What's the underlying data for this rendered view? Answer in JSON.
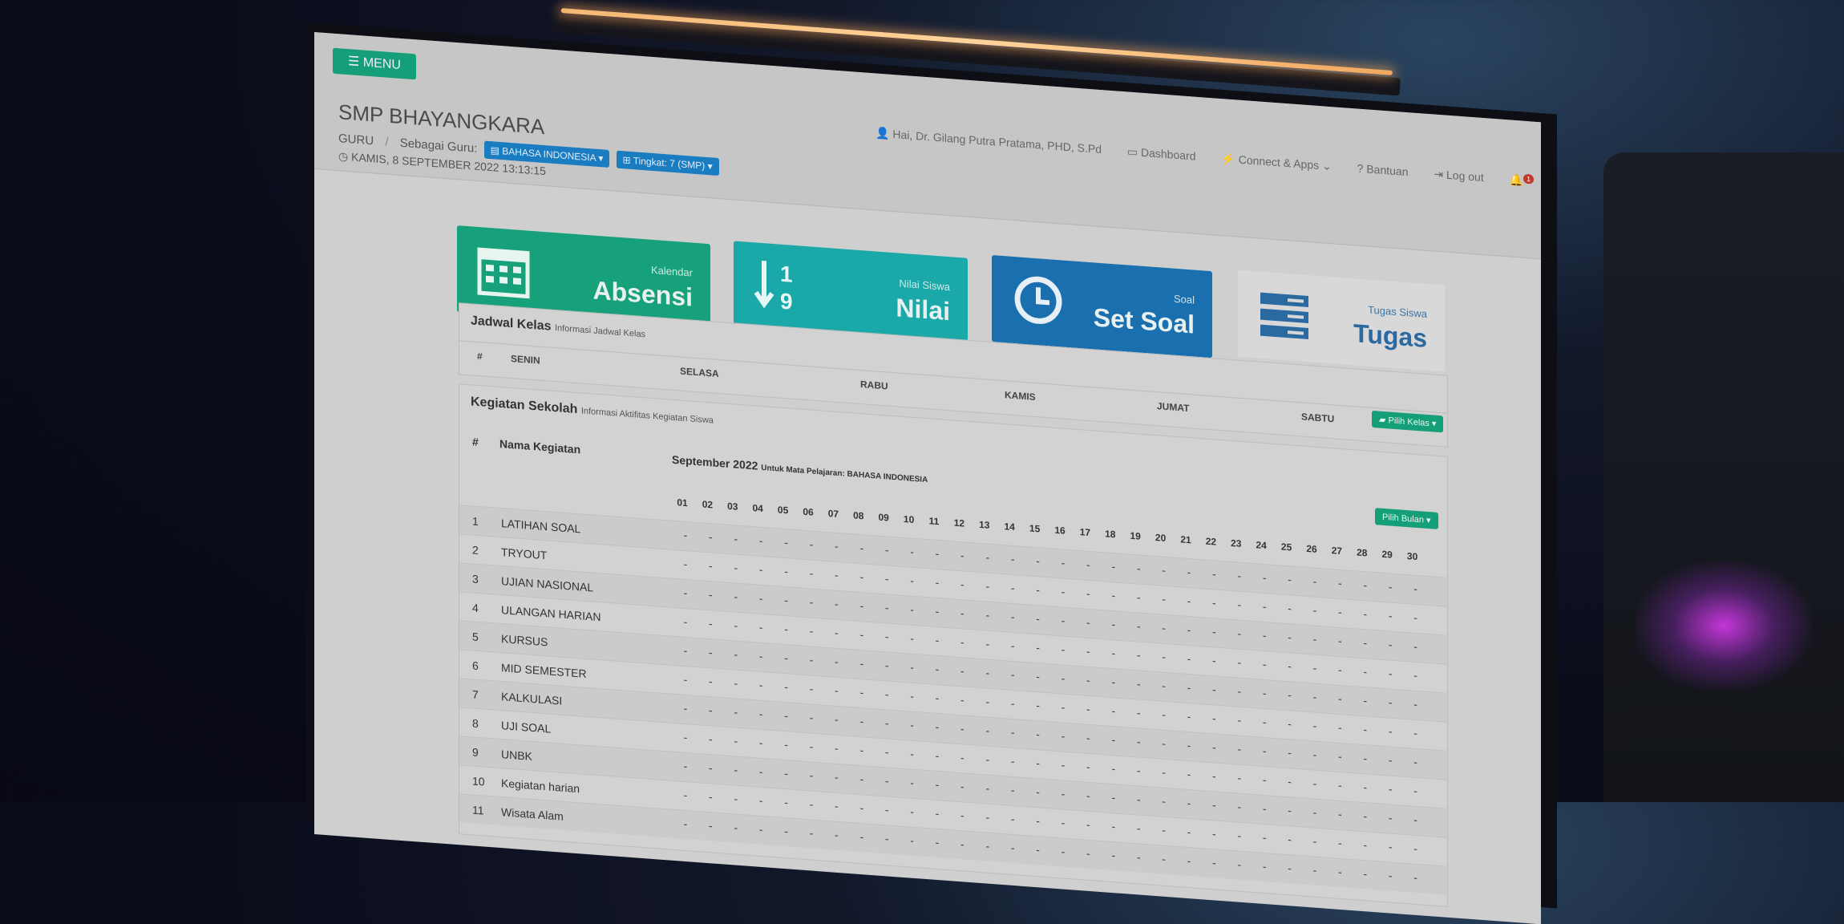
{
  "header": {
    "menu_label": "MENU",
    "school_name": "SMP BHAYANGKARA",
    "breadcrumb_role": "GURU",
    "breadcrumb_as": "Sebagai Guru:",
    "subject_select": "BAHASA INDONESIA",
    "level_select": "Tingkat: 7 (SMP)",
    "datetime": "KAMIS, 8 SEPTEMBER 2022 13:13:15"
  },
  "usernav": {
    "greeting": "Hai, Dr. Gilang Putra Pratama, PHD, S.Pd",
    "dashboard": "Dashboard",
    "connect": "Connect & Apps",
    "help": "Bantuan",
    "logout": "Log out",
    "notif_count": "1"
  },
  "cards": [
    {
      "sub": "Kalendar",
      "title": "Absensi",
      "icon": "calendar-icon"
    },
    {
      "sub": "Nilai Siswa",
      "title": "Nilai",
      "icon": "sort-numeric-icon"
    },
    {
      "sub": "Soal",
      "title": "Set Soal",
      "icon": "clock-icon"
    },
    {
      "sub": "Tugas Siswa",
      "title": "Tugas",
      "icon": "tasks-icon"
    }
  ],
  "schedule": {
    "title": "Jadwal Kelas",
    "subtitle": "Informasi Jadwal Kelas",
    "columns": [
      "#",
      "SENIN",
      "SELASA",
      "RABU",
      "KAMIS",
      "JUMAT",
      "SABTU"
    ],
    "select_button": "Pilih Kelas"
  },
  "activities": {
    "title": "Kegiatan Sekolah",
    "subtitle": "Informasi Aktifitas Kegiatan Siswa",
    "col_no": "#",
    "col_name": "Nama Kegiatan",
    "month": "September 2022",
    "month_note": "Untuk Mata Pelajaran: BAHASA INDONESIA",
    "select_button": "Pilih Bulan",
    "days": [
      "01",
      "02",
      "03",
      "04",
      "05",
      "06",
      "07",
      "08",
      "09",
      "10",
      "11",
      "12",
      "13",
      "14",
      "15",
      "16",
      "17",
      "18",
      "19",
      "20",
      "21",
      "22",
      "23",
      "24",
      "25",
      "26",
      "27",
      "28",
      "29",
      "30"
    ],
    "rows": [
      {
        "no": "1",
        "name": "LATIHAN SOAL"
      },
      {
        "no": "2",
        "name": "TRYOUT"
      },
      {
        "no": "3",
        "name": "UJIAN NASIONAL"
      },
      {
        "no": "4",
        "name": "ULANGAN HARIAN"
      },
      {
        "no": "5",
        "name": "KURSUS"
      },
      {
        "no": "6",
        "name": "MID SEMESTER"
      },
      {
        "no": "7",
        "name": "KALKULASI"
      },
      {
        "no": "8",
        "name": "UJI SOAL"
      },
      {
        "no": "9",
        "name": "UNBK"
      },
      {
        "no": "10",
        "name": "Kegiatan harian"
      },
      {
        "no": "11",
        "name": "Wisata Alam"
      }
    ],
    "empty_cell": "-"
  },
  "colors": {
    "green": "#149f78",
    "teal": "#1aa8a8",
    "blue": "#1a6fae",
    "pill": "#1a7cc1",
    "badge": "#c0392b"
  }
}
